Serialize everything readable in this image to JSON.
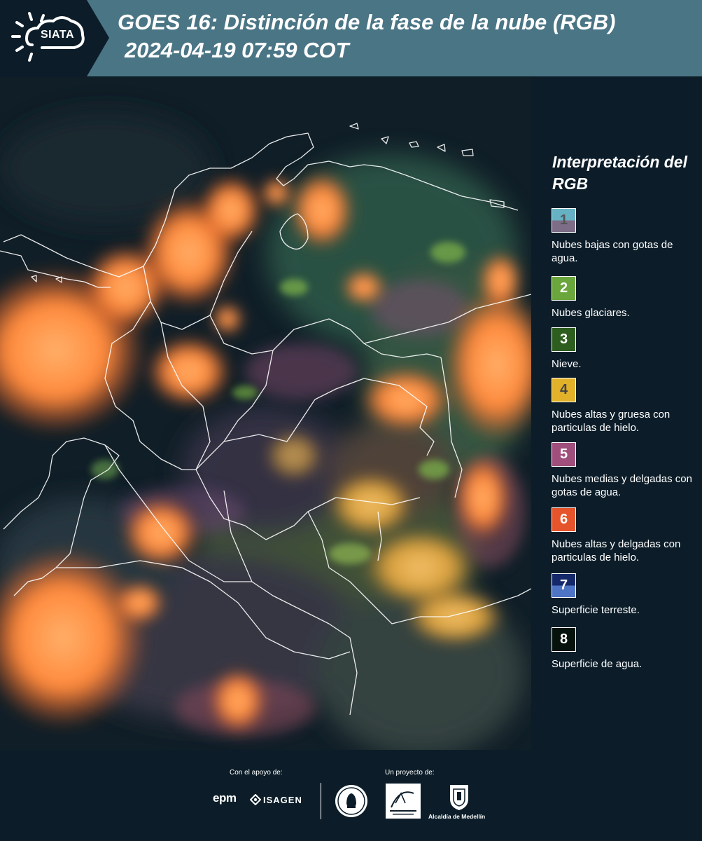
{
  "header": {
    "logo_text": "SIATA",
    "title_line1": "GOES 16: Distinción de la fase de la nube (RGB)",
    "title_line2": "2024-04-19 07:59 COT",
    "background_color": "#4a7585"
  },
  "legend": {
    "title": "Interpretación del RGB",
    "items": [
      {
        "number": "1",
        "label": "Nubes bajas con gotas de agua.",
        "color_top": "#66b2c4",
        "color_bottom": "#7e6d86",
        "number_color": "#555555"
      },
      {
        "number": "2",
        "label": "Nubes glaciares.",
        "color_top": "#6aa63c",
        "color_bottom": "#6aa63c",
        "number_color": "#ffffff"
      },
      {
        "number": "3",
        "label": "Nieve.",
        "color_top": "#2d5d1f",
        "color_bottom": "#2d5d1f",
        "number_color": "#ffffff"
      },
      {
        "number": "4",
        "label": "Nubes altas y gruesa con particulas de hielo.",
        "color_top": "#e1b12a",
        "color_bottom": "#e1b12a",
        "number_color": "#444444"
      },
      {
        "number": "5",
        "label": "Nubes medias y delgadas con gotas de agua.",
        "color_top": "#a04f7c",
        "color_bottom": "#a04f7c",
        "number_color": "#ffffff"
      },
      {
        "number": "6",
        "label": "Nubes altas y delgadas con particulas de hielo.",
        "color_top": "#e5542a",
        "color_bottom": "#e5542a",
        "number_color": "#ffffff"
      },
      {
        "number": "7",
        "label": "Superficie terreste.",
        "color_top": "#14286a",
        "color_bottom": "#4e74c4",
        "number_color": "#ffffff"
      },
      {
        "number": "8",
        "label": "Superficie de agua.",
        "color_top": "#06120c",
        "color_bottom": "#06120c",
        "number_color": "#ffffff"
      }
    ]
  },
  "footer": {
    "support_label": "Con el apoyo de:",
    "project_label": "Un proyecto de:",
    "sponsors": [
      "epm",
      "ISAGEN"
    ],
    "alcaldia_label": "Alcaldía de Medellín"
  }
}
